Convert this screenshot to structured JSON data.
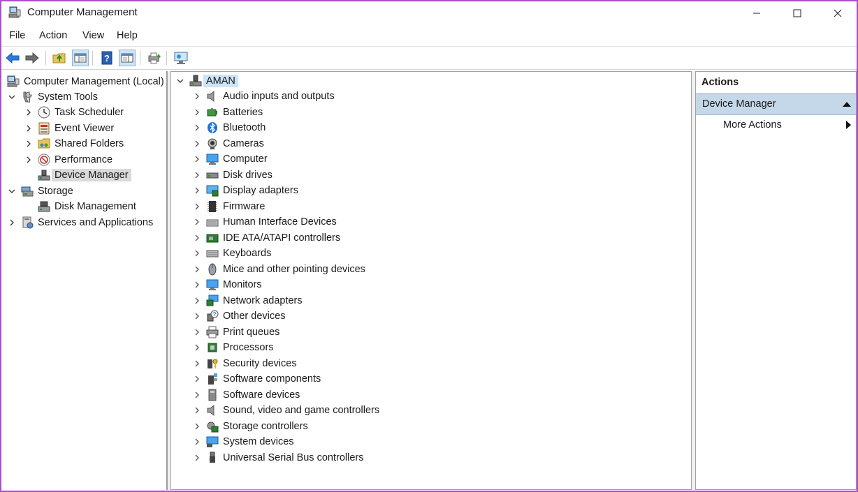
{
  "window": {
    "title": "Computer Management"
  },
  "menu": {
    "file": "File",
    "action": "Action",
    "view": "View",
    "help": "Help"
  },
  "toolbar": [
    "back-icon",
    "forward-icon",
    "up-folder-icon",
    "show-hide-tree-icon",
    "help-icon",
    "action-pane-icon",
    "export-icon",
    "monitor-icon"
  ],
  "tree": {
    "root": "Computer Management (Local)",
    "system_tools": "System Tools",
    "task_scheduler": "Task Scheduler",
    "event_viewer": "Event Viewer",
    "shared_folders": "Shared Folders",
    "performance": "Performance",
    "device_manager": "Device Manager",
    "storage": "Storage",
    "disk_management": "Disk Management",
    "services_apps": "Services and Applications"
  },
  "devices": {
    "computer_name": "AMAN",
    "categories": [
      {
        "label": "Audio inputs and outputs",
        "icon": "speaker-icon"
      },
      {
        "label": "Batteries",
        "icon": "battery-icon"
      },
      {
        "label": "Bluetooth",
        "icon": "bluetooth-icon"
      },
      {
        "label": "Cameras",
        "icon": "camera-icon"
      },
      {
        "label": "Computer",
        "icon": "computer-icon"
      },
      {
        "label": "Disk drives",
        "icon": "disk-drive-icon"
      },
      {
        "label": "Display adapters",
        "icon": "display-adapter-icon"
      },
      {
        "label": "Firmware",
        "icon": "firmware-icon"
      },
      {
        "label": "Human Interface Devices",
        "icon": "hid-icon"
      },
      {
        "label": "IDE ATA/ATAPI controllers",
        "icon": "ide-controller-icon"
      },
      {
        "label": "Keyboards",
        "icon": "keyboard-icon"
      },
      {
        "label": "Mice and other pointing devices",
        "icon": "mouse-icon"
      },
      {
        "label": "Monitors",
        "icon": "monitor-icon"
      },
      {
        "label": "Network adapters",
        "icon": "network-adapter-icon"
      },
      {
        "label": "Other devices",
        "icon": "other-devices-icon"
      },
      {
        "label": "Print queues",
        "icon": "printer-icon"
      },
      {
        "label": "Processors",
        "icon": "processor-icon"
      },
      {
        "label": "Security devices",
        "icon": "security-device-icon"
      },
      {
        "label": "Software components",
        "icon": "software-component-icon"
      },
      {
        "label": "Software devices",
        "icon": "software-device-icon"
      },
      {
        "label": "Sound, video and game controllers",
        "icon": "sound-controller-icon"
      },
      {
        "label": "Storage controllers",
        "icon": "storage-controller-icon"
      },
      {
        "label": "System devices",
        "icon": "system-devices-icon"
      },
      {
        "label": "Universal Serial Bus controllers",
        "icon": "usb-icon"
      }
    ]
  },
  "actions": {
    "header": "Actions",
    "section": "Device Manager",
    "more": "More Actions"
  },
  "colors": {
    "frame": "#a84ecb",
    "section_bg": "#c5d8ea",
    "selected_bg": "#dadada",
    "highlight_bg": "#cce4f7"
  }
}
